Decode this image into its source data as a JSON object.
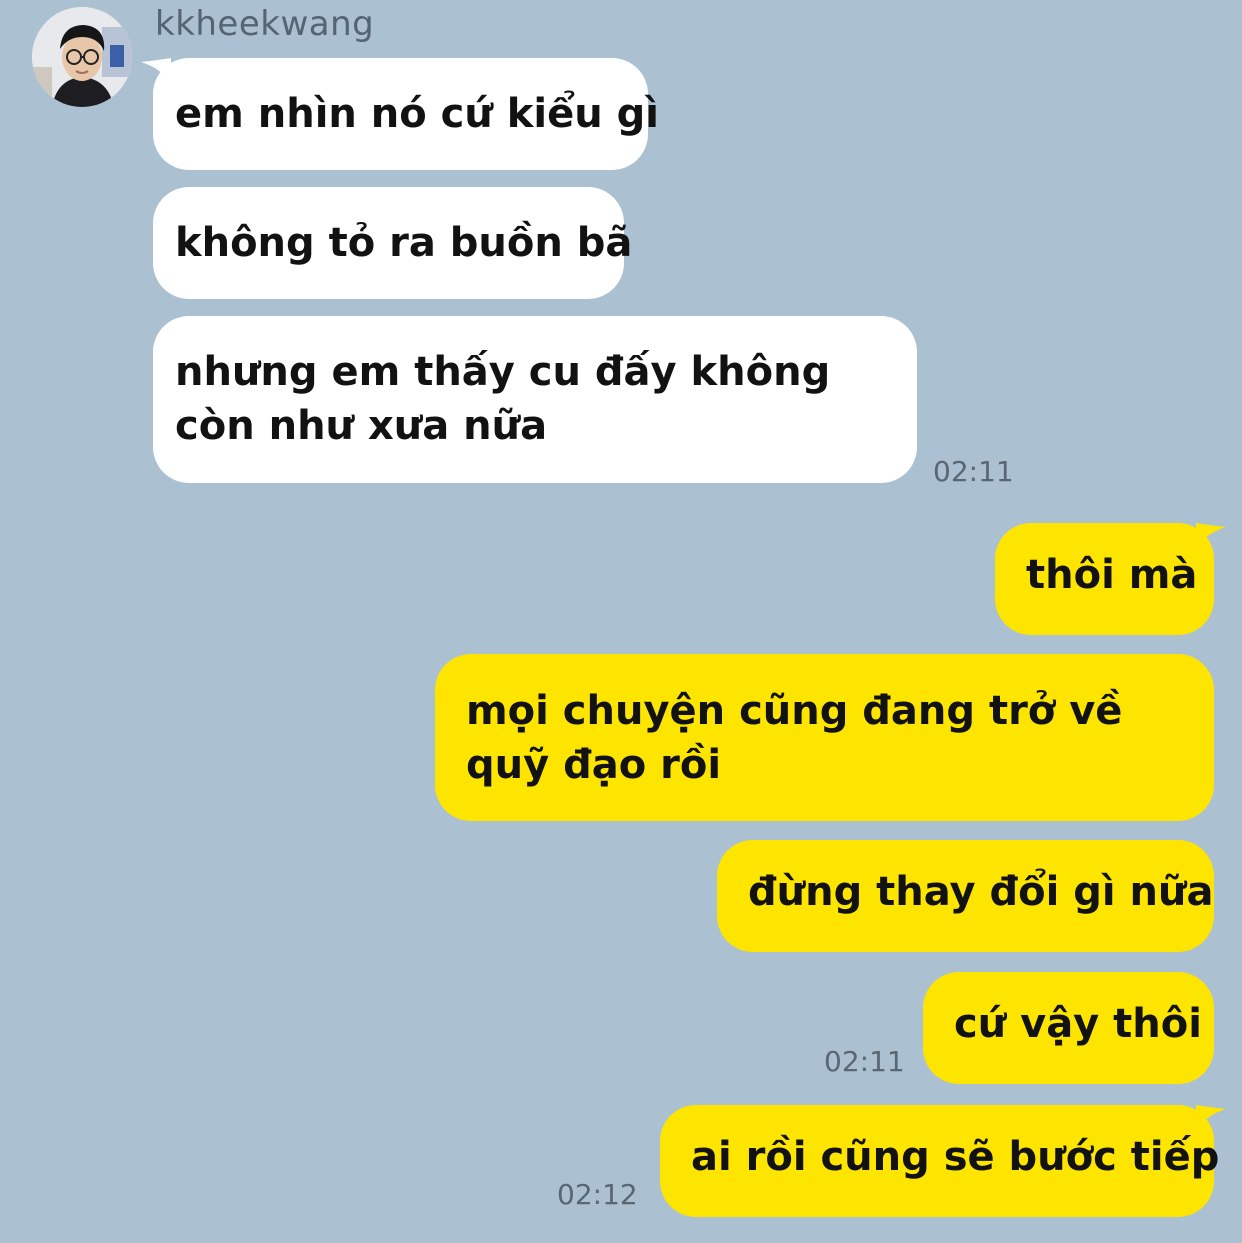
{
  "sender": {
    "name": "kkheekwang"
  },
  "messages_in": [
    {
      "text": "em nhìn nó cứ kiểu gì"
    },
    {
      "text": "không tỏ ra buồn bã"
    },
    {
      "text": "nhưng em thấy cu đấy không còn như xưa nữa"
    }
  ],
  "messages_out": [
    {
      "text": "thôi mà"
    },
    {
      "text": "mọi chuyện cũng đang trở về quỹ đạo rồi"
    },
    {
      "text": "đừng thay đổi gì nữa"
    },
    {
      "text": "cứ vậy thôi"
    },
    {
      "text": "ai rồi cũng sẽ bước tiếp"
    }
  ],
  "timestamps": {
    "in_group": "02:11",
    "out_group_1": "02:11",
    "out_last": "02:12"
  },
  "colors": {
    "background": "#abc1d1",
    "incoming_bubble": "#ffffff",
    "outgoing_bubble": "#fee500",
    "timestamp": "#5a6672"
  },
  "icons": {
    "avatar": "profile-photo"
  }
}
